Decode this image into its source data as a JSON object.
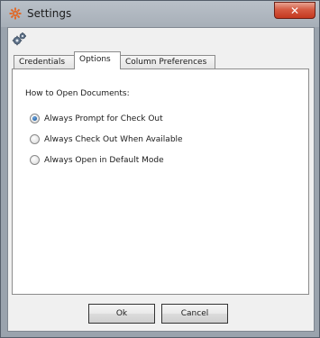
{
  "window": {
    "title": "Settings"
  },
  "tabs": [
    {
      "label": "Credentials",
      "active": false
    },
    {
      "label": "Options",
      "active": true
    },
    {
      "label": "Column Preferences",
      "active": false
    }
  ],
  "options": {
    "heading": "How to Open Documents:",
    "radios": [
      {
        "label": "Always Prompt for Check Out",
        "checked": true
      },
      {
        "label": "Always Check Out When Available",
        "checked": false
      },
      {
        "label": "Always Open in Default Mode",
        "checked": false
      }
    ]
  },
  "buttons": {
    "ok": "Ok",
    "cancel": "Cancel"
  },
  "icons": {
    "app": "settings-gear-icon",
    "toolbar": "gears-icon",
    "close": "close-icon"
  },
  "colors": {
    "close_button": "#c4381f",
    "titlebar": "#a7afb8",
    "radio_selected": "#1d5c9e"
  }
}
